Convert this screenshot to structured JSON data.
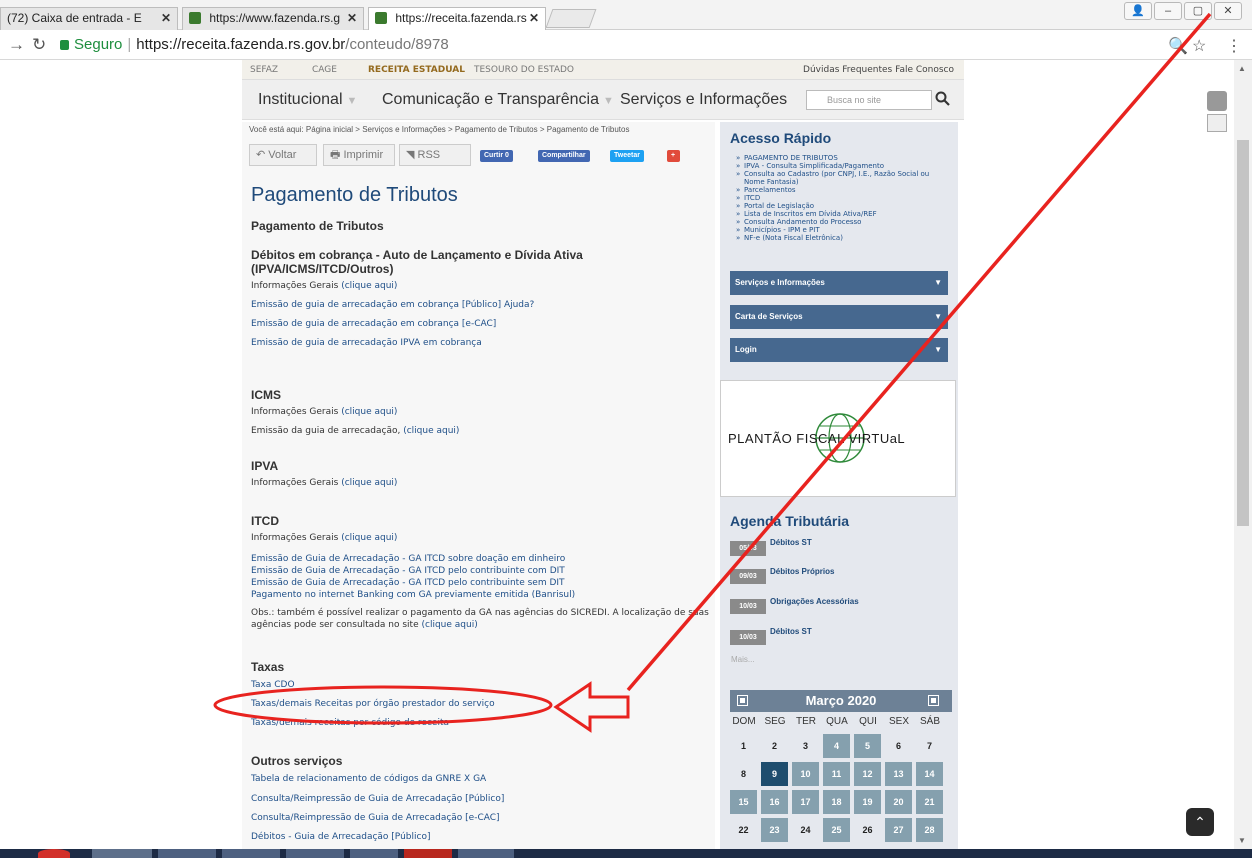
{
  "browser": {
    "tabs": [
      {
        "label": "(72) Caixa de entrada - E"
      },
      {
        "label": "https://www.fazenda.rs.g"
      },
      {
        "label": "https://receita.fazenda.rs"
      }
    ],
    "address": {
      "secure_label": "Seguro",
      "url_host": "https://receita.fazenda.rs.gov.br",
      "url_path": "/conteudo/8978"
    }
  },
  "site": {
    "top_links": [
      "SEFAZ",
      "CAGE",
      "RECEITA ESTADUAL",
      "TESOURO DO ESTADO"
    ],
    "top_right": "Dúvidas Frequentes   Fale Conosco",
    "nav": [
      "Institucional",
      "Comunicação e Transparência",
      "Serviços e Informações"
    ],
    "search_placeholder": "Busca no site"
  },
  "content": {
    "breadcrumb": "Você está aqui: Página inicial > Serviços e Informações > Pagamento de Tributos > Pagamento de Tributos",
    "toolbar": {
      "back": "Voltar",
      "print": "Imprimir",
      "rss": "RSS",
      "like": "Curtir 0",
      "share": "Compartilhar",
      "tweet": "Tweetar"
    },
    "page_title": "Pagamento de Tributos",
    "section_title": "Pagamento de Tributos",
    "debitos_title": "Débitos em cobrança - Auto de Lançamento e Dívida Ativa (IPVA/ICMS/ITCD/Outros)",
    "info_gerais": "Informações Gerais",
    "clique_aqui": "(clique aqui)",
    "debitos_links": [
      "Emissão de guia de arrecadação em cobrança [Público]  Ajuda?",
      "Emissão de guia de arrecadação em cobrança [e-CAC]",
      "Emissão de guia de arrecadação IPVA em cobrança"
    ],
    "icms_title": "ICMS",
    "icms_emissao": "Emissão da guia de arrecadação,",
    "ipva_title": "IPVA",
    "itcd_title": "ITCD",
    "itcd_links": [
      "Emissão de Guia de Arrecadação - GA ITCD sobre doação em dinheiro",
      "Emissão de Guia de Arrecadação - GA ITCD pelo contribuinte com DIT",
      "Emissão de Guia de Arrecadação - GA ITCD pelo contribuinte sem DIT",
      "Pagamento no internet Banking com GA previamente emitida (Banrisul)"
    ],
    "itcd_note": "Obs.: também é possível realizar o pagamento da GA nas agências do SICREDI. A localização de suas agências pode ser consultada no site",
    "taxas_title": "Taxas",
    "taxas_links": [
      "Taxa CDO",
      "Taxas/demais Receitas por órgão prestador do serviço",
      "Taxas/demais receitas por código de receita"
    ],
    "outros_title": "Outros serviços",
    "outros_links": [
      "Tabela de relacionamento de códigos da GNRE X GA",
      "Consulta/Reimpressão de Guia de Arrecadação [Público]",
      "Consulta/Reimpressão de Guia de Arrecadação [e-CAC]",
      "Débitos - Guia de Arrecadação [Público]"
    ]
  },
  "sidebar": {
    "acesso_title": "Acesso Rápido",
    "quick_links": [
      "PAGAMENTO DE TRIBUTOS",
      "IPVA - Consulta Simplificada/Pagamento",
      "Consulta ao Cadastro (por CNPJ, I.E., Razão Social ou Nome Fantasia)",
      "Parcelamentos",
      "ITCD",
      "Portal de Legislação",
      "Lista de Inscritos em Dívida Ativa/REF",
      "Consulta Andamento do Processo",
      "Municípios - IPM e PIT",
      "NF-e (Nota Fiscal Eletrônica)"
    ],
    "accordions": [
      "Serviços e Informações",
      "Carta de Serviços",
      "Login"
    ],
    "plantao": "PLANTÃO FISCAL VIRTUaL",
    "agenda_title": "Agenda Tributária",
    "agenda_items": [
      {
        "date": "05/03",
        "label": "Débitos ST"
      },
      {
        "date": "09/03",
        "label": "Débitos Próprios"
      },
      {
        "date": "10/03",
        "label": "Obrigações Acessórias"
      },
      {
        "date": "10/03",
        "label": "Débitos ST"
      }
    ],
    "agenda_more": "Mais...",
    "calendar": {
      "month": "Março 2020",
      "dow": [
        "DOM",
        "SEG",
        "TER",
        "QUA",
        "QUI",
        "SEX",
        "SÁB"
      ],
      "weeks": [
        [
          "1",
          "2",
          "3",
          "4",
          "5",
          "6",
          "7"
        ],
        [
          "8",
          "9",
          "10",
          "11",
          "12",
          "13",
          "14"
        ],
        [
          "15",
          "16",
          "17",
          "18",
          "19",
          "20",
          "21"
        ],
        [
          "22",
          "23",
          "24",
          "25",
          "26",
          "27",
          "28"
        ]
      ],
      "event_days": [
        "4",
        "5",
        "10",
        "11",
        "12",
        "13",
        "14",
        "15",
        "16",
        "17",
        "18",
        "19",
        "20",
        "21",
        "23",
        "25",
        "27",
        "28"
      ],
      "today": "9"
    }
  },
  "colors": {
    "title_blue": "#1f4a7a",
    "link_blue": "#1f4f88",
    "accordion": "#46688f",
    "annotation_red": "#e8231f"
  }
}
